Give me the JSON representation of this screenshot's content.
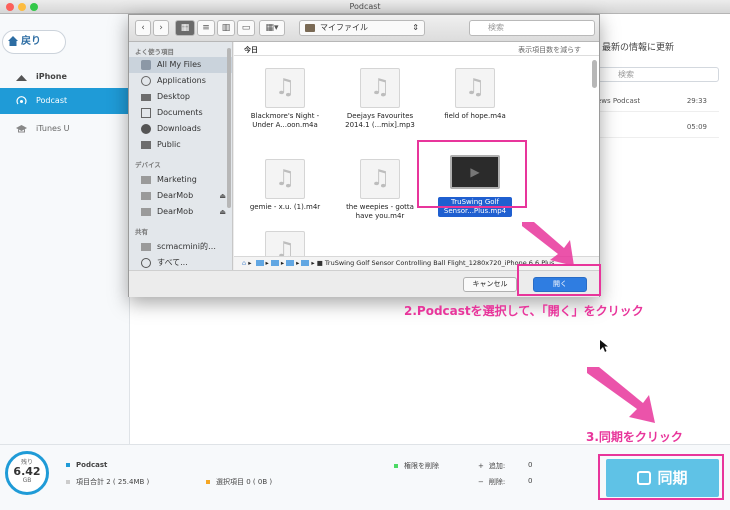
{
  "window": {
    "title": "Podcast"
  },
  "sidebar": {
    "back_label": "戻り",
    "items": [
      {
        "label": "iPhone"
      },
      {
        "label": "Podcast"
      },
      {
        "label": "iTunes U"
      }
    ]
  },
  "right_panel": {
    "header": "最新の情報に更新",
    "search_placeholder": "検索",
    "rows": [
      {
        "title": "ews Podcast",
        "duration": "29:33"
      },
      {
        "title": "",
        "duration": "05:09"
      }
    ]
  },
  "bottom": {
    "capacity_label": "残り",
    "capacity_value": "6.42",
    "capacity_unit": "GB",
    "section_title": "Podcast",
    "total_items": "項目合計 2 ( 25.4MB )",
    "selected_items": "選択項目 0 ( 0B )",
    "delete_label": "権限を削除",
    "add_label": "追加:",
    "add_count": "0",
    "remove_label": "削除:",
    "remove_count": "0",
    "sync_label": "同期",
    "colors": {
      "accent": "#1f9bd7",
      "selected_dot": "#f5a623",
      "green_dot": "#4cd964"
    }
  },
  "dialog": {
    "location": "マイファイル",
    "search_placeholder": "検索",
    "today_label": "今日",
    "show_less": "表示項目数を減らす",
    "favorites_head": "よく使う項目",
    "favorites": [
      {
        "label": "All My Files",
        "icon": "all-files-icon"
      },
      {
        "label": "Applications",
        "icon": "applications-icon"
      },
      {
        "label": "Desktop",
        "icon": "desktop-icon"
      },
      {
        "label": "Documents",
        "icon": "documents-icon"
      },
      {
        "label": "Downloads",
        "icon": "downloads-icon"
      },
      {
        "label": "Public",
        "icon": "folder-icon"
      }
    ],
    "devices_head": "デバイス",
    "devices": [
      {
        "label": "Marketing"
      },
      {
        "label": "DearMob"
      },
      {
        "label": "DearMob"
      }
    ],
    "shared_head": "共有",
    "shared": [
      {
        "label": "scmacmini的…"
      },
      {
        "label": "すべて..."
      }
    ],
    "files": [
      {
        "line1": "Blackmore's Night -",
        "line2": "Under A...oon.m4a"
      },
      {
        "line1": "Deejays Favourites",
        "line2": "2014.1 (...mix].mp3"
      },
      {
        "line1": "field of hope.m4a",
        "line2": ""
      },
      {
        "line1": "gemie - x.u. (1).m4r",
        "line2": ""
      },
      {
        "line1": "the weepies - gotta",
        "line2": "have you.m4r"
      },
      {
        "line1": "TruSwing Golf",
        "line2": "Sensor...Plus.mp4"
      },
      {
        "line1": "",
        "line2": ""
      }
    ],
    "path_text": "TruSwing Golf Sensor  Controlling Ball Flight_1280x720_iPhone 6 6 Plus",
    "cancel_label": "キャンセル",
    "open_label": "開く"
  },
  "annotations": {
    "step2": "2.Podcastを選択して、「開く」をクリック",
    "step3": "3.同期をクリック",
    "color": "#e8359b"
  }
}
